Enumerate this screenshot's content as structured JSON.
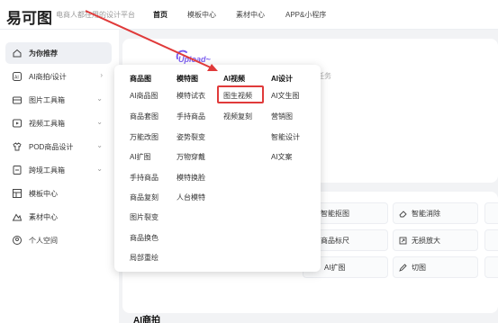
{
  "header": {
    "logo": "易可图",
    "slogan": "电商人都在用的设计平台",
    "nav": [
      "首页",
      "模板中心",
      "素材中心",
      "APP&小程序"
    ]
  },
  "sidebar": {
    "items": [
      {
        "label": "为你推荐",
        "icon": "home-icon"
      },
      {
        "label": "AI商拍/设计",
        "icon": "ai-icon"
      },
      {
        "label": "图片工具箱",
        "icon": "image-tools-icon"
      },
      {
        "label": "视频工具箱",
        "icon": "video-tools-icon"
      },
      {
        "label": "POD商品设计",
        "icon": "pod-icon"
      },
      {
        "label": "跨境工具箱",
        "icon": "cross-border-icon"
      },
      {
        "label": "模板中心",
        "icon": "template-icon"
      },
      {
        "label": "素材中心",
        "icon": "material-icon"
      },
      {
        "label": "个人空间",
        "icon": "user-icon"
      }
    ]
  },
  "upload": {
    "tag": "Upload~",
    "hint": "的任务"
  },
  "tools": {
    "row1": [
      "智能抠图",
      "智能消除"
    ],
    "row2": [
      "商品标尺",
      "无损放大"
    ],
    "row3": [
      "AI扩图",
      "切图"
    ]
  },
  "section_title": "AI商拍",
  "menu": {
    "columns": [
      {
        "header": "商品图",
        "items": [
          "AI商品图",
          "商品套图",
          "万能改图",
          "AI扩图",
          "手持商品",
          "商品复刻",
          "图片裂变",
          "商品换色",
          "局部重绘"
        ]
      },
      {
        "header": "模特图",
        "items": [
          "模特试衣",
          "手持商品",
          "姿势裂变",
          "万物穿戴",
          "模特换脸",
          "人台模特"
        ]
      },
      {
        "header": "AI视频",
        "items": [
          "图生视频",
          "视频复刻"
        ]
      },
      {
        "header": "AI设计",
        "items": [
          "AI文生图",
          "营销图",
          "智能设计",
          "AI文案"
        ]
      }
    ]
  },
  "colors": {
    "highlight": "#e03a3a",
    "accent": "#7a5cf0"
  }
}
